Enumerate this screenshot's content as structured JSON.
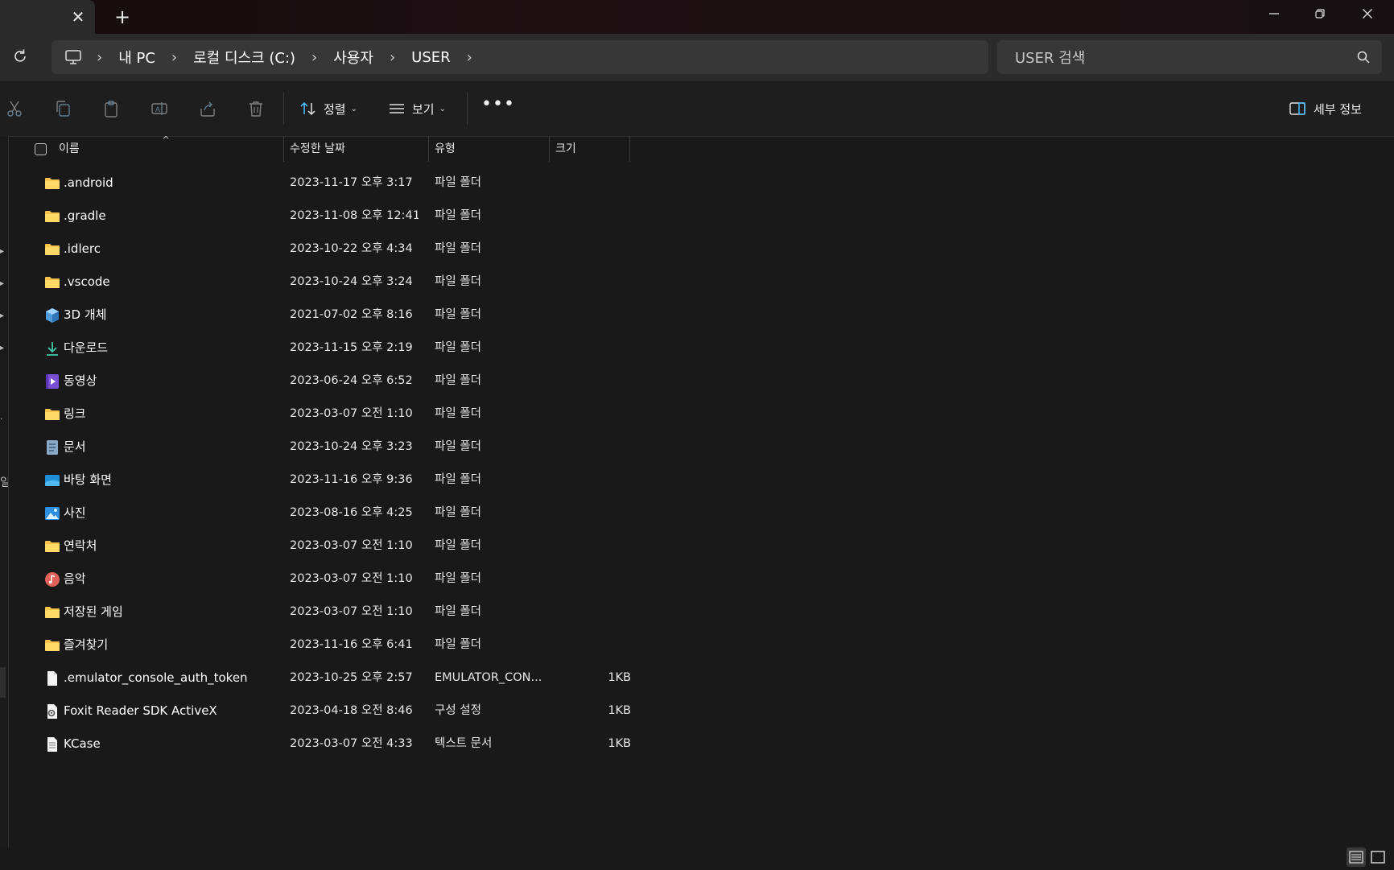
{
  "titlebar": {
    "tab_close": "✕",
    "new_tab": "+",
    "minimize": "—",
    "maximize": "❐",
    "close": "✕"
  },
  "address": {
    "crumbs": [
      "내 PC",
      "로컬 디스크 (C:)",
      "사용자",
      "USER"
    ],
    "search_placeholder": "USER 검색"
  },
  "toolbar": {
    "sort_label": "정렬",
    "view_label": "보기",
    "more_label": "•••",
    "details_label": "세부 정보",
    "icons": [
      "cut-icon",
      "copy-icon",
      "paste-icon",
      "rename-icon",
      "share-icon",
      "delete-icon"
    ]
  },
  "columns": {
    "name": "이름",
    "date": "수정한 날짜",
    "type": "유형",
    "size": "크기"
  },
  "files": [
    {
      "name": ".android",
      "date": "2023-11-17 오후 3:17",
      "type": "파일 폴더",
      "size": "",
      "icon": "folder-icon"
    },
    {
      "name": ".gradle",
      "date": "2023-11-08 오후 12:41",
      "type": "파일 폴더",
      "size": "",
      "icon": "folder-icon"
    },
    {
      "name": ".idlerc",
      "date": "2023-10-22 오후 4:34",
      "type": "파일 폴더",
      "size": "",
      "icon": "folder-icon"
    },
    {
      "name": ".vscode",
      "date": "2023-10-24 오후 3:24",
      "type": "파일 폴더",
      "size": "",
      "icon": "folder-icon"
    },
    {
      "name": "3D 개체",
      "date": "2021-07-02 오후 8:16",
      "type": "파일 폴더",
      "size": "",
      "icon": "3d-objects-icon"
    },
    {
      "name": "다운로드",
      "date": "2023-11-15 오후 2:19",
      "type": "파일 폴더",
      "size": "",
      "icon": "downloads-icon"
    },
    {
      "name": "동영상",
      "date": "2023-06-24 오후 6:52",
      "type": "파일 폴더",
      "size": "",
      "icon": "videos-icon"
    },
    {
      "name": "링크",
      "date": "2023-03-07 오전 1:10",
      "type": "파일 폴더",
      "size": "",
      "icon": "folder-icon"
    },
    {
      "name": "문서",
      "date": "2023-10-24 오후 3:23",
      "type": "파일 폴더",
      "size": "",
      "icon": "documents-icon"
    },
    {
      "name": "바탕 화면",
      "date": "2023-11-16 오후 9:36",
      "type": "파일 폴더",
      "size": "",
      "icon": "desktop-icon"
    },
    {
      "name": "사진",
      "date": "2023-08-16 오후 4:25",
      "type": "파일 폴더",
      "size": "",
      "icon": "pictures-icon"
    },
    {
      "name": "연락처",
      "date": "2023-03-07 오전 1:10",
      "type": "파일 폴더",
      "size": "",
      "icon": "folder-icon"
    },
    {
      "name": "음악",
      "date": "2023-03-07 오전 1:10",
      "type": "파일 폴더",
      "size": "",
      "icon": "music-icon"
    },
    {
      "name": "저장된 게임",
      "date": "2023-03-07 오전 1:10",
      "type": "파일 폴더",
      "size": "",
      "icon": "folder-icon"
    },
    {
      "name": "즐겨찾기",
      "date": "2023-11-16 오후 6:41",
      "type": "파일 폴더",
      "size": "",
      "icon": "folder-icon"
    },
    {
      "name": ".emulator_console_auth_token",
      "date": "2023-10-25 오후 2:57",
      "type": "EMULATOR_CON...",
      "size": "1KB",
      "icon": "file-icon"
    },
    {
      "name": "Foxit Reader SDK ActiveX",
      "date": "2023-04-18 오전 8:46",
      "type": "구성 설정",
      "size": "1KB",
      "icon": "config-file-icon"
    },
    {
      "name": "KCase",
      "date": "2023-03-07 오전 4:33",
      "type": "텍스트 문서",
      "size": "1KB",
      "icon": "text-file-icon"
    }
  ],
  "nav_fragments": [
    "일",
    "."
  ],
  "colors": {
    "folder": "#f5c24a",
    "accent": "#4cc2ff",
    "background": "#191919"
  }
}
